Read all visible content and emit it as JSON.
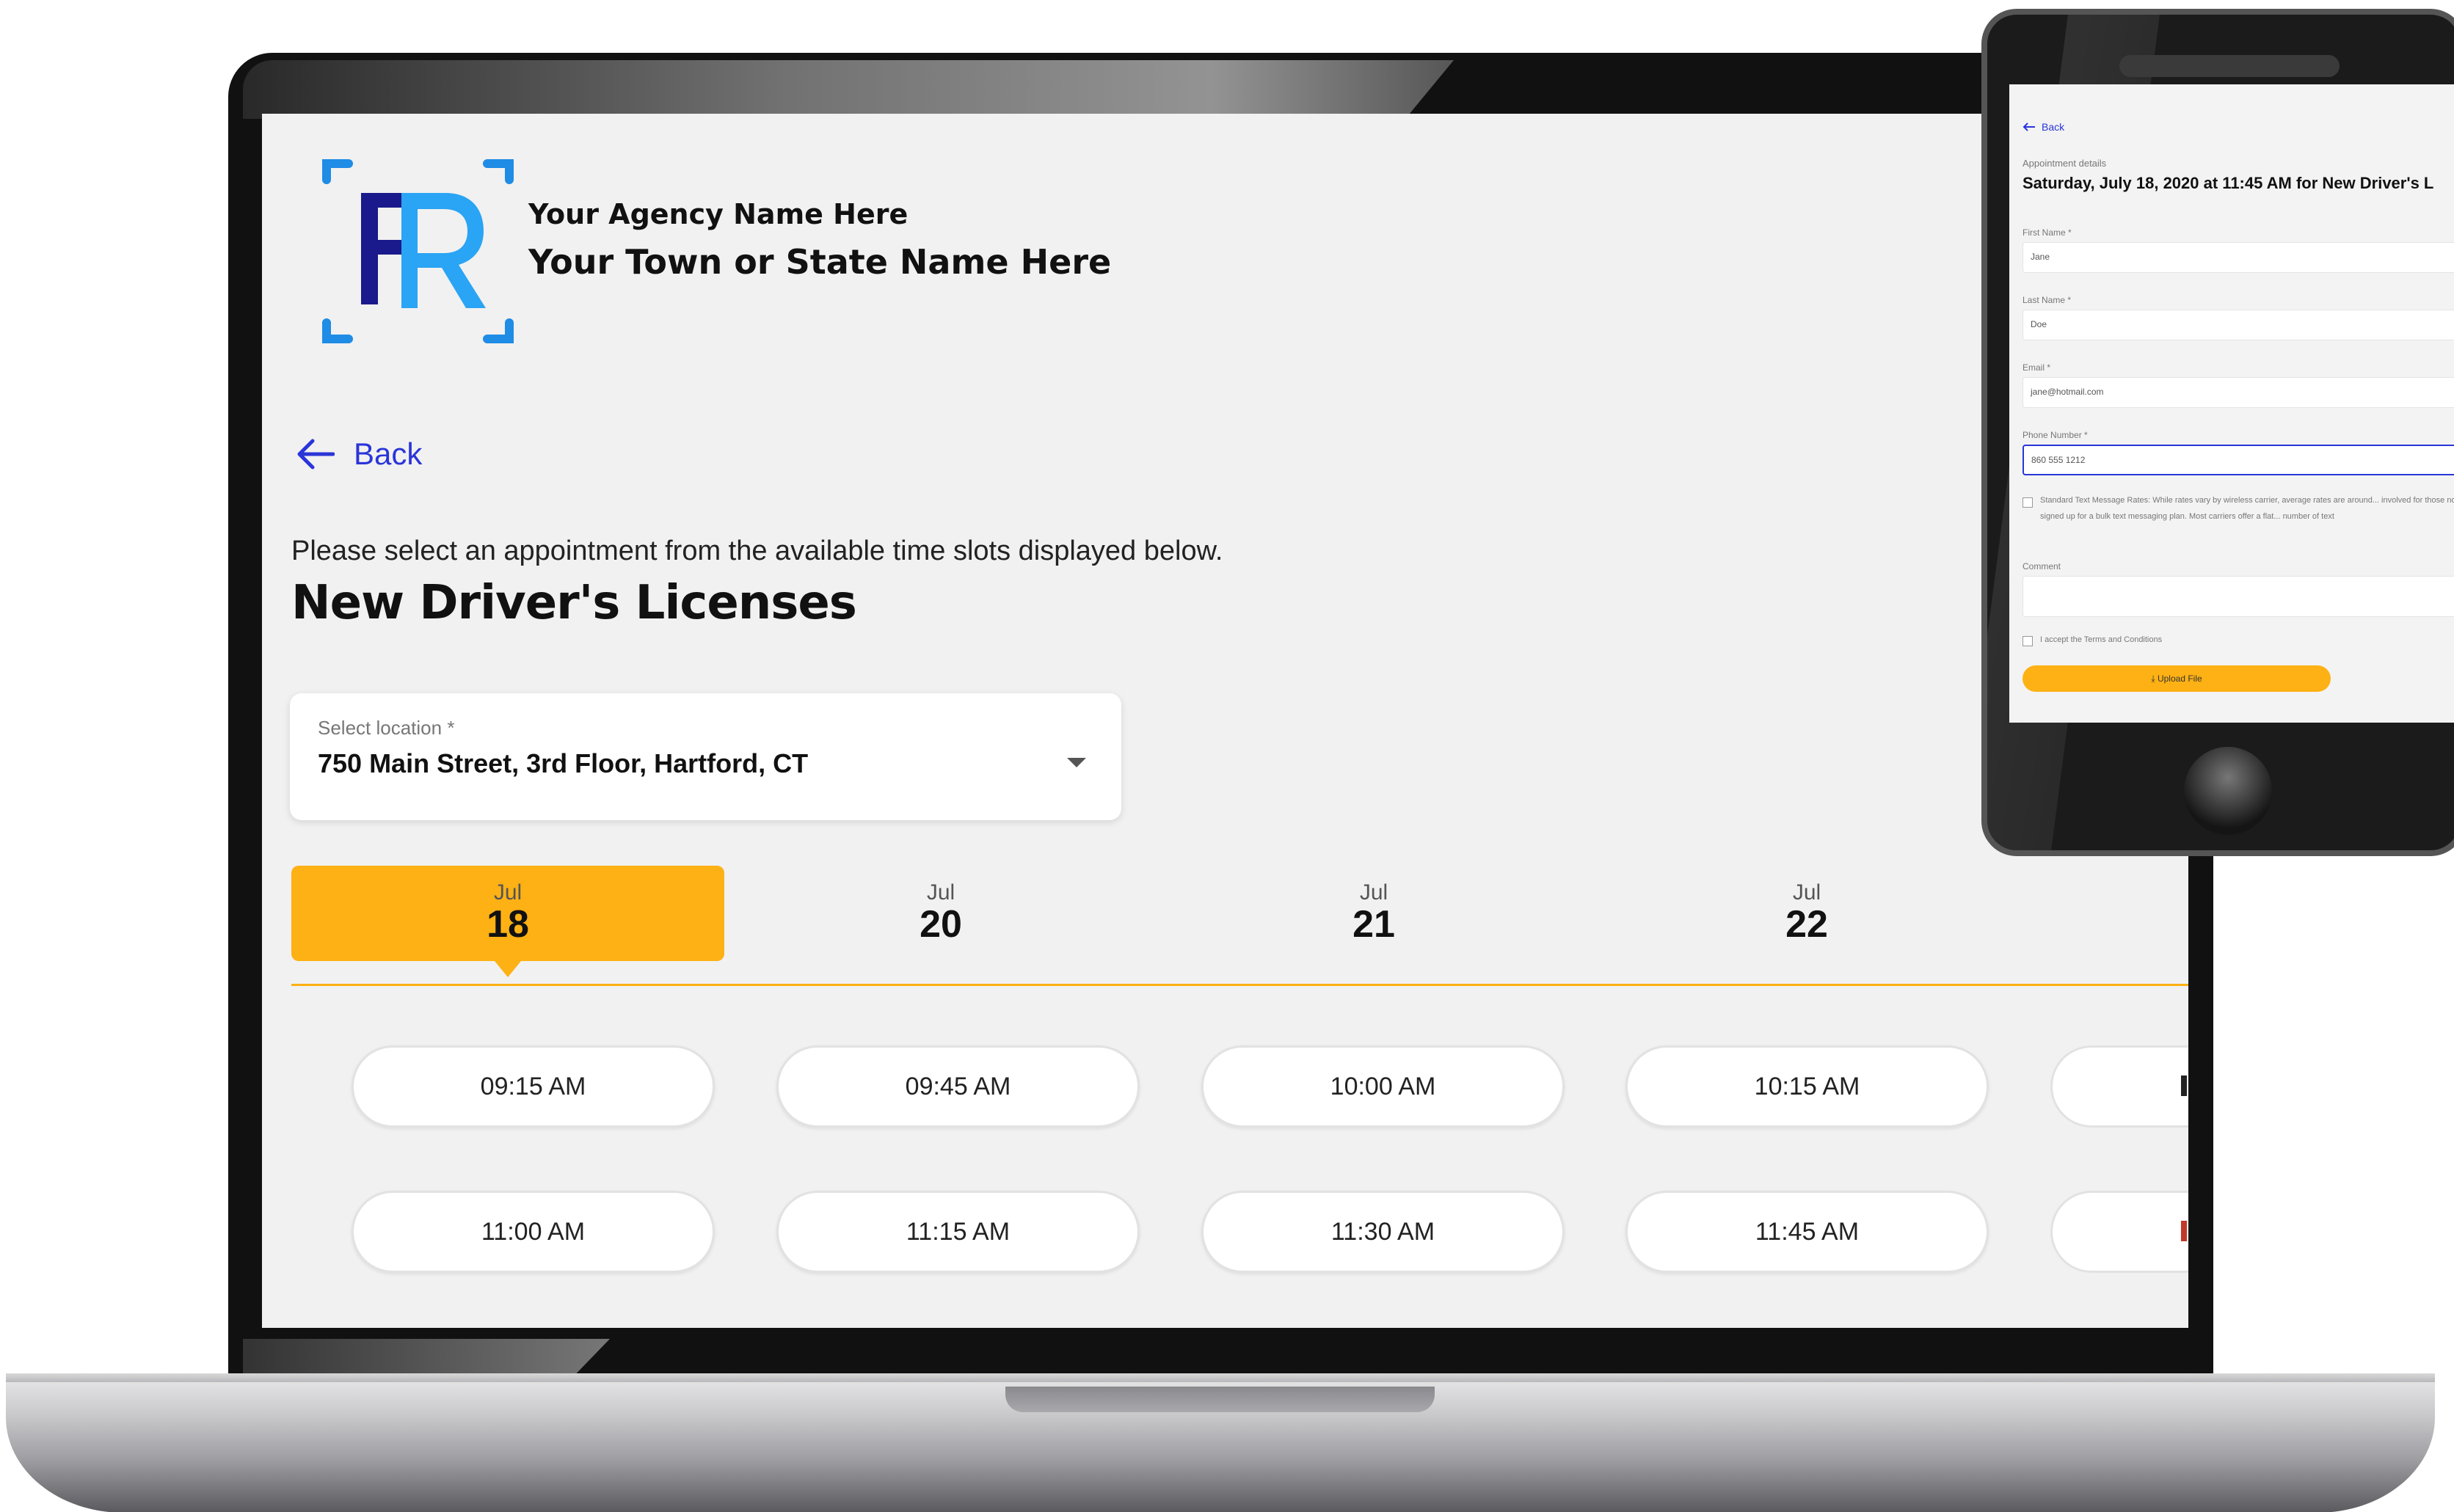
{
  "brand": {
    "agency_name": "Your Agency Name Here",
    "town_name": "Your Town or State Name Here",
    "logo_letters": "FR",
    "accent_color": "#fdb114",
    "link_color": "#2a35d8"
  },
  "nav": {
    "back_label": "Back"
  },
  "page": {
    "instructions": "Please select an appointment from the available time slots displayed below.",
    "service_title": "New Driver's Licenses"
  },
  "location": {
    "label": "Select location *",
    "value": "750 Main Street, 3rd Floor, Hartford, CT"
  },
  "dates": [
    {
      "month": "Jul",
      "day": "18",
      "selected": true
    },
    {
      "month": "Jul",
      "day": "20",
      "selected": false
    },
    {
      "month": "Jul",
      "day": "21",
      "selected": false
    },
    {
      "month": "Jul",
      "day": "22",
      "selected": false
    }
  ],
  "time_slots": [
    [
      "09:15 AM",
      "09:45 AM",
      "10:00 AM",
      "10:15 AM"
    ],
    [
      "11:00 AM",
      "11:15 AM",
      "11:30 AM",
      "11:45 AM"
    ]
  ],
  "phone": {
    "back_label": "Back",
    "section_label": "Appointment details",
    "heading": "Saturday, July 18, 2020 at 11:45 AM for New Driver's L",
    "fields": [
      {
        "label": "First Name *",
        "value": "Jane"
      },
      {
        "label": "Last Name *",
        "value": "Doe"
      },
      {
        "label": "Email *",
        "value": "jane@hotmail.com"
      },
      {
        "label": "Phone Number *",
        "value": "860 555 1212"
      }
    ],
    "sms_text": "Standard Text Message Rates: While rates vary by wireless carrier, average rates are around... involved for those not signed up for a bulk text messaging plan. Most carriers offer a flat... number of text",
    "comment_label": "Comment",
    "terms_label": "I accept the Terms and Conditions",
    "upload_label": "Upload File"
  }
}
